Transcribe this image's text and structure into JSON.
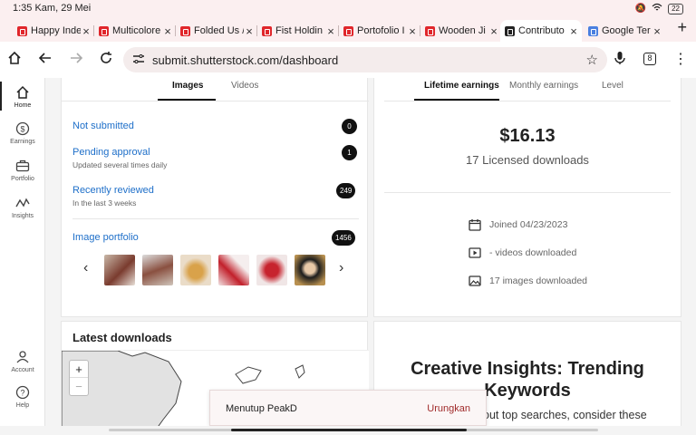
{
  "status_bar": {
    "time": "1:35 Kam, 29 Mei",
    "battery": "22"
  },
  "tabs": [
    {
      "title": "Happy Inde",
      "icon": "shutterstock-icon"
    },
    {
      "title": "Multicolore",
      "icon": "shutterstock-icon"
    },
    {
      "title": "Folded Us /",
      "icon": "shutterstock-icon"
    },
    {
      "title": "Fist Holdin",
      "icon": "shutterstock-icon"
    },
    {
      "title": "Portofolio I",
      "icon": "shutterstock-icon"
    },
    {
      "title": "Wooden Ji",
      "icon": "shutterstock-icon"
    },
    {
      "title": "Contributo",
      "icon": "contributor-icon",
      "active": true
    },
    {
      "title": "Google Ter",
      "icon": "translate-icon"
    }
  ],
  "toolbar": {
    "url": "submit.shutterstock.com/dashboard",
    "tab_count": "8"
  },
  "sidebar": {
    "items": [
      {
        "label": "Home",
        "icon": "home-icon",
        "active": true
      },
      {
        "label": "Earnings",
        "icon": "dollar-icon"
      },
      {
        "label": "Portfolio",
        "icon": "briefcase-icon"
      },
      {
        "label": "Insights",
        "icon": "insights-icon"
      },
      {
        "label": "Account",
        "icon": "user-icon"
      },
      {
        "label": "Help",
        "icon": "help-icon"
      }
    ]
  },
  "images_card": {
    "tabs": [
      "Images",
      "Videos"
    ],
    "rows": [
      {
        "label": "Not submitted",
        "sub": "",
        "count": "0"
      },
      {
        "label": "Pending approval",
        "sub": "Updated several times daily",
        "count": "1"
      },
      {
        "label": "Recently reviewed",
        "sub": "In the last 3 weeks",
        "count": "249"
      }
    ],
    "portfolio": {
      "label": "Image portfolio",
      "count": "1456"
    }
  },
  "earnings_card": {
    "tabs": [
      "Lifetime earnings",
      "Monthly earnings",
      "Level"
    ],
    "amount": "$16.13",
    "licensed": "17 Licensed downloads",
    "stats": [
      {
        "icon": "calendar-icon",
        "text": "Joined 04/23/2023"
      },
      {
        "icon": "video-icon",
        "text": "- videos downloaded"
      },
      {
        "icon": "image-icon",
        "text": "17 images downloaded"
      }
    ]
  },
  "latest": {
    "title": "Latest downloads",
    "zoom_in": "+",
    "zoom_out": "−"
  },
  "insights": {
    "title_line1": "Creative Insights: Trending",
    "title_line2": "Keywords",
    "body": "out top searches, consider these"
  },
  "snackbar": {
    "message": "Menutup PeakD",
    "action": "Urungkan"
  },
  "colors": {
    "link": "#1e6fc9",
    "brand_red": "#e0262b",
    "undo": "#a02b2b"
  }
}
